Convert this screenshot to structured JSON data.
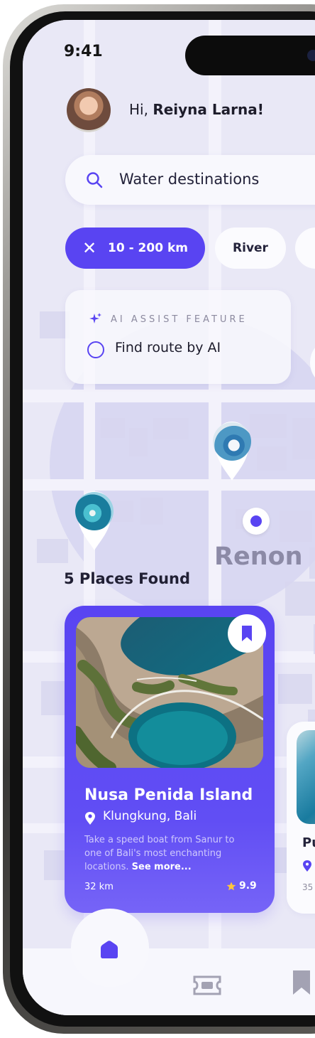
{
  "status_bar": {
    "time": "9:41"
  },
  "header": {
    "greeting_prefix": "Hi, ",
    "user_name": "Reiyna Larna!"
  },
  "search": {
    "value": "Water destinations",
    "icon": "search-icon"
  },
  "filters": {
    "active": {
      "label": "10 - 200 km",
      "icon": "close-icon"
    },
    "items": [
      {
        "label": "River"
      }
    ]
  },
  "ai_assist": {
    "kicker": "AI ASSIST FEATURE",
    "option": "Find route by AI",
    "icon": "sparkle-icon"
  },
  "map": {
    "area_label": "Renon",
    "results_label": "5 Places Found"
  },
  "places": [
    {
      "title": "Nusa Penida Island",
      "location": "Klungkung, Bali",
      "description": "Take a speed boat from Sanur to one of Bali's most enchanting locations.",
      "see_more": "See more...",
      "distance": "32 km",
      "rating": "9.9"
    },
    {
      "title_partial": "Pu",
      "distance_partial": "35"
    }
  ],
  "tabs": [
    {
      "icon": "home-icon"
    },
    {
      "icon": "ticket-icon"
    },
    {
      "icon": "bookmark-icon"
    }
  ],
  "colors": {
    "accent": "#5944F2",
    "background": "#EEEDF8",
    "map_label": "#8C8AA6",
    "card_white": "#FBFBFE"
  }
}
